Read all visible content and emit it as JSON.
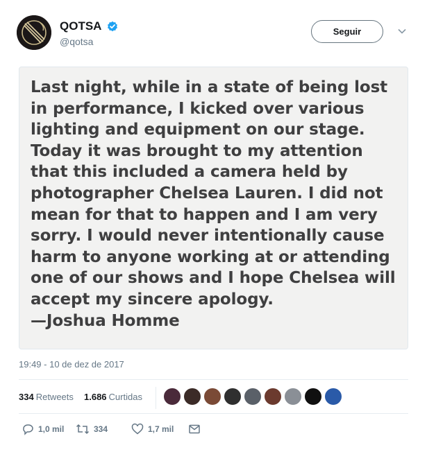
{
  "tweet": {
    "display_name": "QOTSA",
    "handle": "@qotsa",
    "follow_label": "Seguir",
    "statement_lines": [
      "Last night, while in a state of being lost",
      "in performance,  I kicked over various",
      "lighting and equipment on our stage.",
      "Today it was brought to my attention",
      "that this included a camera held by",
      "photographer Chelsea Lauren. I did not",
      "mean for that to happen and I am very",
      "sorry. I would never intentionally cause",
      "harm to anyone working at or attending",
      "one of our shows and I hope Chelsea will",
      "accept my sincere apology.",
      "—Joshua Homme"
    ],
    "timestamp": "19:49 - 10 de dez de 2017",
    "retweets": {
      "count": "334",
      "label": "Retweets"
    },
    "likes": {
      "count": "1.686",
      "label": "Curtidas"
    },
    "actions": {
      "reply_count": "1,0 mil",
      "retweet_count": "334",
      "like_count": "1,7 mil"
    }
  },
  "icons": {
    "verified": "verified-badge-icon",
    "caret": "chevron-down-icon",
    "reply": "reply-icon",
    "retweet": "retweet-icon",
    "like": "heart-icon",
    "dm": "envelope-icon"
  },
  "colors": {
    "verified_blue": "#1da1f2",
    "muted_text": "#657786",
    "image_background": "#f2f2f1",
    "statement_text": "#3f3f40"
  },
  "likers_faces": [
    "#4a2a3a",
    "#3b2b27",
    "#7a4a36",
    "#2f2f2f",
    "#5a6068",
    "#6b3a2e",
    "#8a8f96",
    "#101010",
    "#2a5aa8"
  ]
}
